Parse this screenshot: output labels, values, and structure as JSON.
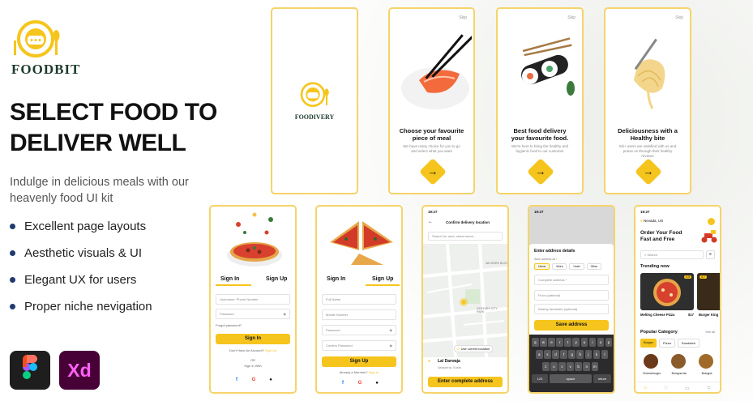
{
  "brand": {
    "name": "FOODBIT",
    "color": "#1c3b2c",
    "accent": "#f6c51d"
  },
  "hero": {
    "headline_line1": "SELECT FOOD TO",
    "headline_line2": "DELIVER WELL",
    "subtitle_line1": "Indulge in delicious meals with our",
    "subtitle_line2": "heavenly food UI kit"
  },
  "features": [
    "Excellent page layouts",
    "Aesthetic visuals & UI",
    "Elegant UX for users",
    "Proper niche nevigation"
  ],
  "tools": [
    {
      "icon": "figma-icon"
    },
    {
      "icon": "adobe-xd-icon",
      "label": "Xd"
    }
  ],
  "splash": {
    "name": "FOODIVERY"
  },
  "onboarding": [
    {
      "skip": "Skip",
      "title_1": "Choose your favourite",
      "title_2": "piece of meal",
      "desc_1": "We have many choice for you to go",
      "desc_2": "and select what you want",
      "arrow": "→"
    },
    {
      "skip": "Skip",
      "title_1": "Best food delivery",
      "title_2": "your favourite food.",
      "desc_1": "We're here to bring the healthy and",
      "desc_2": "hygienic food to our customer",
      "arrow": "→"
    },
    {
      "skip": "Skip",
      "title_1": "Deliciousness with a",
      "title_2": "Healthy bite",
      "desc_1": "Ski+ users are satisfied with us and",
      "desc_2": "praise us through their healthy reviews",
      "arrow": "→"
    }
  ],
  "signin": {
    "tab_signin": "Sign In",
    "tab_signup": "Sign Up",
    "username": "Username, Phone Number",
    "password": "Password",
    "forgot": "Forgot password?",
    "button": "Sign In",
    "no_account": "Don't Have An Account?",
    "signup_link": "Sign Up",
    "or": "OR",
    "signin_with": "Sign In With"
  },
  "signup": {
    "tab_signin": "Sign In",
    "tab_signup": "Sign Up",
    "fullname": "Full Name",
    "mobile": "Mobile Number",
    "password": "Password",
    "confirm": "Confirm Password",
    "button": "Sign Up",
    "have_account": "Already a Member?",
    "signin_link": "Sign In"
  },
  "location": {
    "time": "19:27",
    "title": "Confirm delivery location",
    "search": "Search for area, street name...",
    "map_label_1": "WILSHIRE BLVD",
    "map_label_2": "CENTURY CITY PARK",
    "current": "Use current location",
    "place_name": "Lal Darwaja",
    "place_addr": "Varachha, Surat",
    "button": "Enter complete address"
  },
  "address": {
    "time": "19:27",
    "title": "Enter address details",
    "save_as": "Save address as *",
    "chips": [
      "Home",
      "Work",
      "Hotel",
      "Other"
    ],
    "f1": "Complete address *",
    "f2": "Floor (optional)",
    "f3": "Nearby landmark (optional)",
    "button": "Save address",
    "kb_row1": [
      "q",
      "w",
      "e",
      "r",
      "t",
      "y",
      "u",
      "i",
      "o",
      "p"
    ],
    "kb_row2": [
      "a",
      "s",
      "d",
      "f",
      "g",
      "h",
      "j",
      "k",
      "l"
    ],
    "kb_row3": [
      "z",
      "x",
      "c",
      "v",
      "b",
      "n",
      "m"
    ],
    "kb_num": "123",
    "kb_space": "space",
    "kb_return": "return"
  },
  "home": {
    "time": "19:27",
    "location": "Nevada, US",
    "title_1": "Order Your Food",
    "title_2": "Fast and Free",
    "search": "Search",
    "trending": "Trending now",
    "items": [
      {
        "name": "Melting Cheese Pizza",
        "price": "$17",
        "rating": "4.9"
      },
      {
        "name": "Burger King",
        "price": "",
        "rating": "4.7"
      }
    ],
    "popular": "Popular Category",
    "see_all": "See all",
    "chips": [
      "Burger",
      "Pizza",
      "Sandwich"
    ],
    "foods": [
      "Cheeseburger",
      "Bologna fan",
      "Bologna"
    ]
  }
}
